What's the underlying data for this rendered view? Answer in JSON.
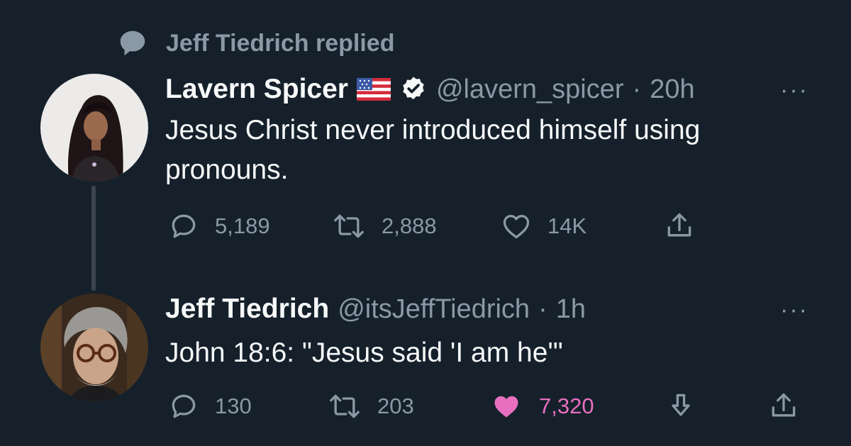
{
  "context": {
    "text": "Jeff Tiedrich replied",
    "icon": "reply-bubble-icon"
  },
  "tweets": [
    {
      "name": "Lavern Spicer",
      "flag": "us-flag-icon",
      "verified": true,
      "handle": "@lavern_spicer",
      "dot": "·",
      "time": "20h",
      "more": "···",
      "text_line1": "Jesus Christ never introduced himself using",
      "text_line2": "pronouns.",
      "stats": {
        "replies": "5,189",
        "retweets": "2,888",
        "likes": "14K"
      }
    },
    {
      "name": "Jeff Tiedrich",
      "handle": "@itsJeffTiedrich",
      "dot": "·",
      "time": "1h",
      "more": "···",
      "text": "John 18:6: \"Jesus said 'I am he'\"",
      "stats": {
        "replies": "130",
        "retweets": "203",
        "likes": "7,320"
      },
      "liked": true
    }
  ],
  "colors": {
    "background": "#15202b",
    "primary_text": "#f7f9f9",
    "secondary_text": "#8b98a5",
    "like_active": "#f91880"
  }
}
